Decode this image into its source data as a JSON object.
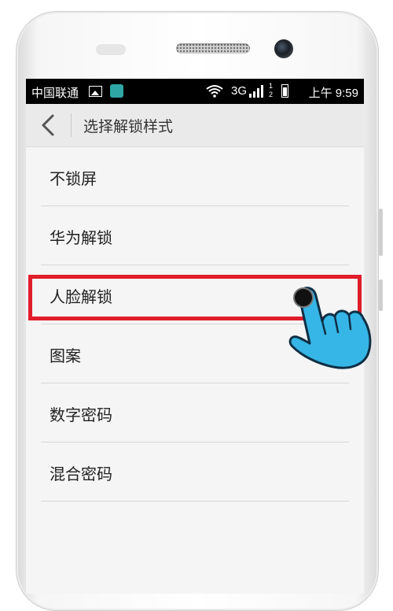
{
  "status_bar": {
    "carrier": "中国联通",
    "network": "3G",
    "sim": "1\n2",
    "time": "上午 9:59"
  },
  "header": {
    "title": "选择解锁样式"
  },
  "lock_options": [
    {
      "label": "不锁屏"
    },
    {
      "label": "华为解锁"
    },
    {
      "label": "人脸解锁"
    },
    {
      "label": "图案"
    },
    {
      "label": "数字密码"
    },
    {
      "label": "混合密码"
    }
  ],
  "annotation": {
    "highlight_color": "#e11d2a",
    "highlighted_option_index": 2
  },
  "colors": {
    "status_bar_bg": "#000000",
    "title_bar_bg": "#eaeaea",
    "list_bg": "#f5f5f5",
    "hand_fill": "#35b6e6"
  },
  "icons": [
    "back-arrow-icon",
    "image-icon",
    "app-icon",
    "wifi-icon",
    "signal-icon",
    "battery-icon",
    "pointing-hand-icon"
  ]
}
